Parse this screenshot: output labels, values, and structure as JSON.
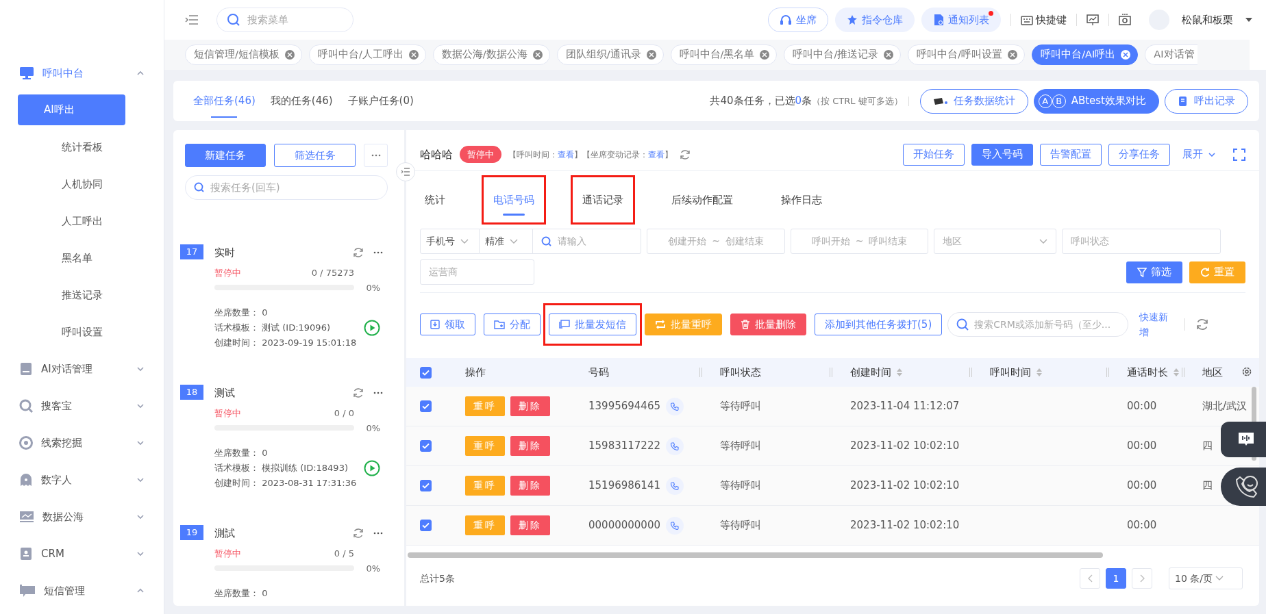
{
  "sidebar": {
    "groups": [
      {
        "label": "呼叫中台",
        "expanded": true,
        "active": true,
        "children": [
          {
            "label": "AI呼出",
            "selected": true
          },
          {
            "label": "统计看板",
            "selected": false
          },
          {
            "label": "人机协同",
            "selected": false
          },
          {
            "label": "人工呼出",
            "selected": false
          },
          {
            "label": "黑名单",
            "selected": false
          },
          {
            "label": "推送记录",
            "selected": false
          },
          {
            "label": "呼叫设置",
            "selected": false
          }
        ]
      },
      {
        "label": "AI对话管理",
        "expanded": false,
        "active": false
      },
      {
        "label": "搜客宝",
        "expanded": false,
        "active": false
      },
      {
        "label": "线索挖掘",
        "expanded": false,
        "active": false
      },
      {
        "label": "数字人",
        "expanded": false,
        "active": false
      },
      {
        "label": "数据公海",
        "expanded": false,
        "active": false
      },
      {
        "label": "CRM",
        "expanded": false,
        "active": false
      },
      {
        "label": "短信管理",
        "expanded": true,
        "active": false
      }
    ]
  },
  "header": {
    "search_placeholder": "搜索菜单",
    "buttons": [
      {
        "label": "坐席",
        "kind": "outline",
        "unread": false
      },
      {
        "label": "指令仓库",
        "kind": "soft",
        "unread": false
      },
      {
        "label": "通知列表",
        "kind": "soft",
        "unread": true
      }
    ],
    "shortcut_label": "快捷键",
    "username": "松鼠和板栗"
  },
  "tags": [
    {
      "label": "短信管理/短信模板",
      "selected": false
    },
    {
      "label": "呼叫中台/人工呼出",
      "selected": false
    },
    {
      "label": "数据公海/数据公海",
      "selected": false
    },
    {
      "label": "团队组织/通讯录",
      "selected": false
    },
    {
      "label": "呼叫中台/黑名单",
      "selected": false
    },
    {
      "label": "呼叫中台/推送记录",
      "selected": false
    },
    {
      "label": "呼叫中台/呼叫设置",
      "selected": false
    },
    {
      "label": "呼叫中台/AI呼出",
      "selected": true
    }
  ],
  "overflow_tag": "AI对话管",
  "task_tabs": [
    {
      "label": "全部任务(46)",
      "selected": true
    },
    {
      "label": "我的任务(46)",
      "selected": false
    },
    {
      "label": "子账户任务(0)",
      "selected": false
    }
  ],
  "summary": {
    "text": "共40条任务，已选",
    "count": "0",
    "unit": "条",
    "hint": "（按 CTRL 键可多选）"
  },
  "actions": [
    {
      "label": "任务数据统计",
      "kind": "outline"
    },
    {
      "label": "ABtest效果对比",
      "kind": "primary",
      "badges": [
        "A",
        "B"
      ]
    },
    {
      "label": "呼出记录",
      "kind": "outline"
    }
  ],
  "task_panel": {
    "new_task": "新建任务",
    "filter_task": "筛选任务",
    "search_placeholder": "搜索任务(回车)",
    "tasks": [
      {
        "number": "17",
        "name": "实时",
        "status": "暂停中",
        "progress_text": "0 / 75273",
        "level": 0,
        "percent": "0%",
        "details": [
          {
            "label": "坐席数量：",
            "value": "0"
          },
          {
            "label": "话术模板：",
            "value": "测试 (ID:19096)"
          },
          {
            "label": "创建时间：",
            "value": "2023-09-19 15:01:18"
          }
        ]
      },
      {
        "number": "18",
        "name": "测试",
        "status": "暂停中",
        "progress_text": "0 / 0",
        "level": 0,
        "percent": "0%",
        "details": [
          {
            "label": "坐席数量：",
            "value": "0"
          },
          {
            "label": "话术模板：",
            "value": "模拟训练 (ID:18493)"
          },
          {
            "label": "创建时间：",
            "value": "2023-08-31 17:31:36"
          }
        ]
      },
      {
        "number": "19",
        "name": "測試",
        "status": "暂停中",
        "progress_text": "0 / 5",
        "level": 0,
        "percent": "0%",
        "details": [
          {
            "label": "坐席数量：",
            "value": "0"
          }
        ]
      }
    ]
  },
  "detail": {
    "title": "哈哈哈",
    "status": "暂停中",
    "meta": [
      {
        "prefix": "【呼叫时间：",
        "link": "查看",
        "suffix": "】"
      },
      {
        "prefix": "【坐席变动记录：",
        "link": "查看",
        "suffix": "】"
      }
    ],
    "buttons": [
      {
        "label": "开始任务",
        "kind": "outline"
      },
      {
        "label": "导入号码",
        "kind": "primary"
      },
      {
        "label": "告警配置",
        "kind": "outline"
      },
      {
        "label": "分享任务",
        "kind": "outline"
      }
    ],
    "expand_link": "展开",
    "tabs": [
      {
        "label": "统计",
        "selected": false,
        "highlighted": false
      },
      {
        "label": "电话号码",
        "selected": true,
        "highlighted": true
      },
      {
        "label": "通话记录",
        "selected": false,
        "highlighted": true
      },
      {
        "label": "后续动作配置",
        "selected": false,
        "highlighted": false
      },
      {
        "label": "操作日志",
        "selected": false,
        "highlighted": false
      }
    ],
    "filters": {
      "phone_type": "手机号",
      "match": "精准",
      "keyword_placeholder": "请输入",
      "created_range": {
        "start": "创建开始",
        "sep": "~",
        "end": "创建结束"
      },
      "call_range": {
        "start": "呼叫开始",
        "sep": "~",
        "end": "呼叫结束"
      },
      "region_placeholder": "地区",
      "call_status_placeholder": "呼叫状态",
      "carrier_placeholder": "运营商",
      "filter_button": "筛选",
      "reset_button": "重置"
    },
    "toolbar": [
      {
        "label": "领取",
        "kind": "outline",
        "highlighted": false
      },
      {
        "label": "分配",
        "kind": "outline",
        "highlighted": false
      },
      {
        "label": "批量发短信",
        "kind": "outline",
        "highlighted": true
      },
      {
        "label": "批量重呼",
        "kind": "warning",
        "highlighted": false
      },
      {
        "label": "批量删除",
        "kind": "danger",
        "highlighted": false
      },
      {
        "label": "添加到其他任务拨打(5)",
        "kind": "outline",
        "highlighted": false
      }
    ],
    "crm_search_placeholder": "搜索CRM或添加新号码（至少...",
    "quick_add": "快速新增",
    "table": {
      "all_checked": true,
      "columns": [
        {
          "label": "操作",
          "sortable": false
        },
        {
          "label": "号码",
          "sortable": false
        },
        {
          "label": "呼叫状态",
          "sortable": false
        },
        {
          "label": "创建时间",
          "sortable": true
        },
        {
          "label": "呼叫时间",
          "sortable": true
        },
        {
          "label": "通话时长",
          "sortable": true
        },
        {
          "label": "地区",
          "sortable": false
        }
      ],
      "rows": [
        {
          "checked": true,
          "actions": [
            "重呼",
            "删除"
          ],
          "number": "13995694465",
          "status": "等待呼叫",
          "created": "2023-11-04 11:12:07",
          "duration": "00:00",
          "region": "湖北/武汉"
        },
        {
          "checked": true,
          "actions": [
            "重呼",
            "删除"
          ],
          "number": "15983117222",
          "status": "等待呼叫",
          "created": "2023-11-02 10:02:10",
          "duration": "00:00",
          "region": "四"
        },
        {
          "checked": true,
          "actions": [
            "重呼",
            "删除"
          ],
          "number": "15196986141",
          "status": "等待呼叫",
          "created": "2023-11-02 10:02:10",
          "duration": "00:00",
          "region": "四"
        },
        {
          "checked": true,
          "actions": [
            "重呼",
            "删除"
          ],
          "number": "00000000000",
          "status": "等待呼叫",
          "created": "2023-11-02 10:02:10",
          "duration": "00:00"
        }
      ]
    },
    "footer": {
      "total": "总计5条",
      "pages": [
        {
          "label": "1",
          "selected": true
        }
      ],
      "page_size": "10 条/页"
    }
  }
}
